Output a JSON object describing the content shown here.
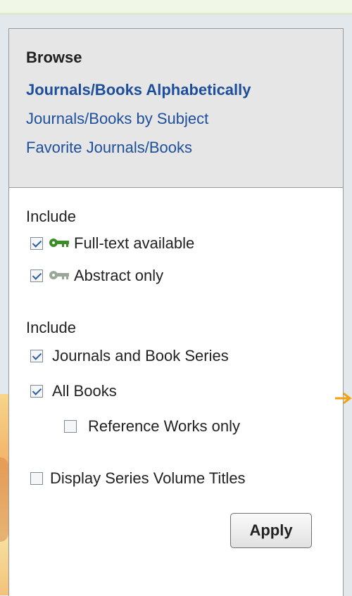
{
  "browse": {
    "title": "Browse",
    "links": [
      {
        "label": "Journals/Books Alphabetically",
        "active": true
      },
      {
        "label": "Journals/Books by Subject",
        "active": false
      },
      {
        "label": "Favorite Journals/Books",
        "active": false
      }
    ]
  },
  "access_filter": {
    "label": "Include",
    "options": [
      {
        "label": "Full-text available",
        "checked": true,
        "icon": "green-key-icon"
      },
      {
        "label": "Abstract only",
        "checked": true,
        "icon": "gray-key-icon"
      }
    ]
  },
  "content_filter": {
    "label": "Include",
    "options": [
      {
        "label": "Journals and Book Series",
        "checked": true
      },
      {
        "label": "All Books",
        "checked": true
      },
      {
        "label": "Reference Works only",
        "checked": false
      }
    ]
  },
  "display_titles": {
    "label": "Display Series Volume Titles",
    "checked": false
  },
  "apply_label": "Apply",
  "colors": {
    "link": "#1d4f9c",
    "key_green": "#3d8c2a",
    "key_gray": "#9aa89a",
    "arrow": "#f2a20c"
  }
}
